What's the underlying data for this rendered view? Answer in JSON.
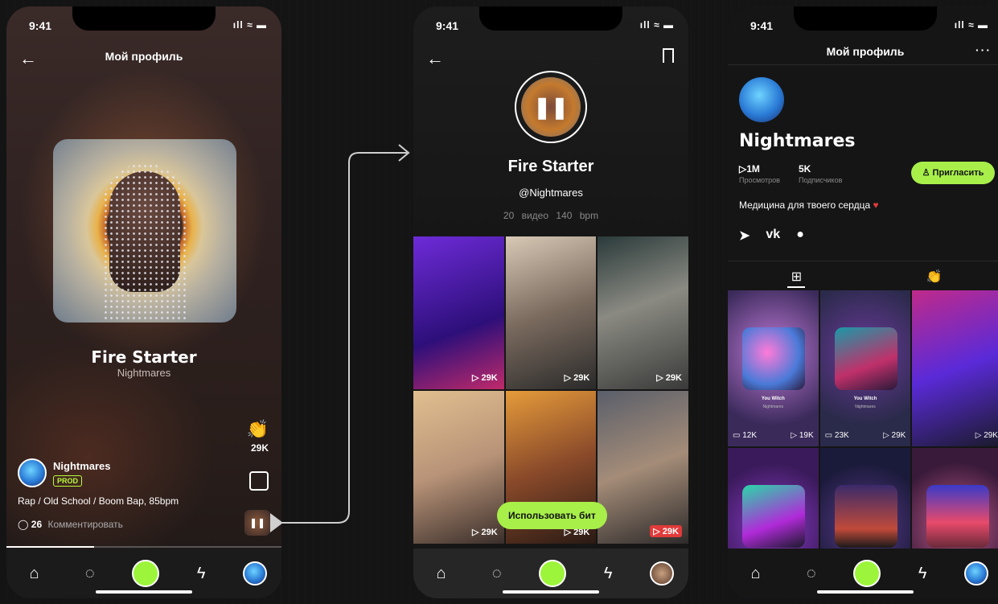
{
  "status": {
    "time": "9:41"
  },
  "player": {
    "header_title": "Мой профиль",
    "track_title": "Fire Starter",
    "artist": "Nightmares",
    "claps": "29K",
    "author_name": "Nightmares",
    "badge": "PROD",
    "genre": "Rap / Old School / Boom Bap, 85bpm",
    "comment_count": "26",
    "comment_label": "Комментировать",
    "progress": 0.32
  },
  "beat": {
    "title": "Fire Starter",
    "handle": "@Nightmares",
    "meta": "20 видео 140 bpm",
    "videos": [
      {
        "count": "29K"
      },
      {
        "count": "29K"
      },
      {
        "count": "29K"
      },
      {
        "count": "29K"
      },
      {
        "count": "29K"
      },
      {
        "count": "29K"
      }
    ],
    "use_beat_label": "Использовать бит"
  },
  "profile": {
    "header_title": "Мой профиль",
    "name": "Nightmares",
    "views_value": "1M",
    "views_label": "Просмотров",
    "subs_value": "5K",
    "subs_label": "Подписчиков",
    "invite_label": "Пригласить",
    "bio": "Медицина для твоего сердца",
    "grid": [
      {
        "title": "You Witch",
        "subtitle": "Nightmares",
        "videos": "12K",
        "plays": "19K"
      },
      {
        "title": "You Witch",
        "subtitle": "Nightmares",
        "videos": "23K",
        "plays": "29K"
      },
      {
        "title": "",
        "subtitle": "",
        "videos": "",
        "plays": "29K"
      }
    ]
  },
  "colors": {
    "accent": "#a8ef4a",
    "heart": "#e23a3a"
  }
}
